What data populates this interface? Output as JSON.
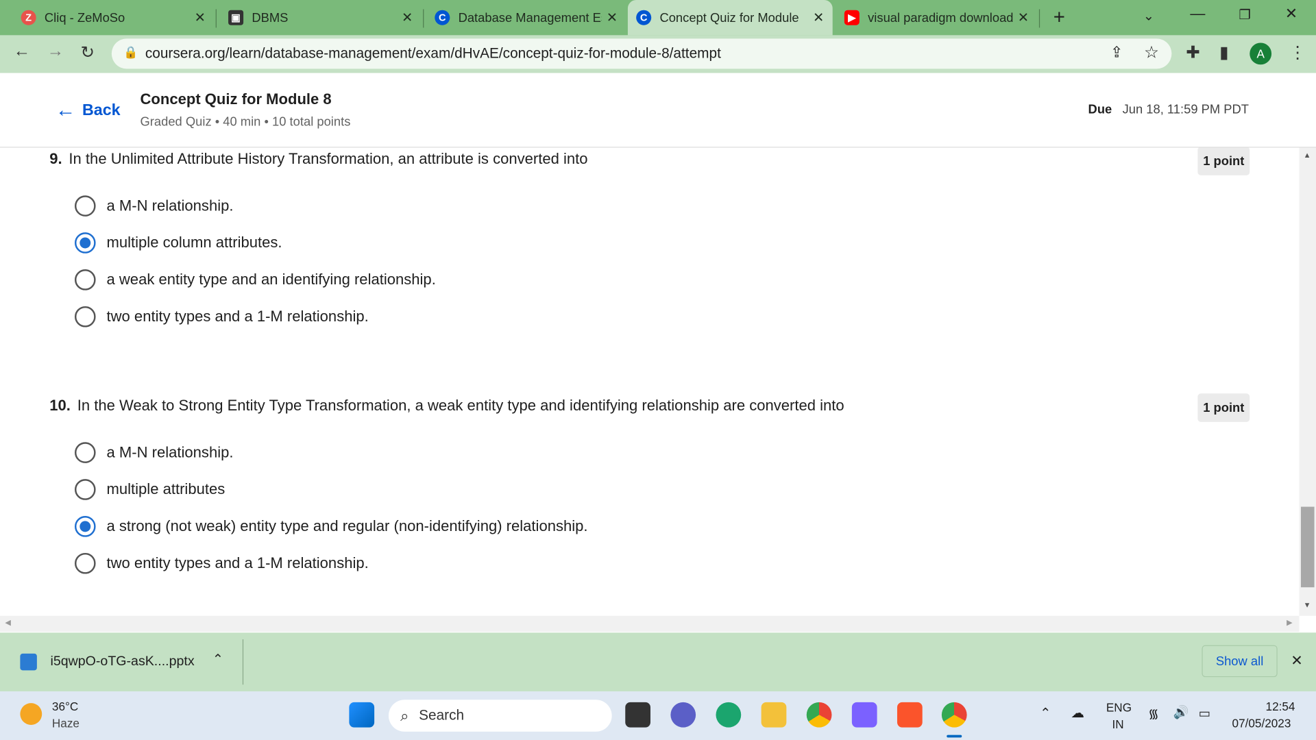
{
  "browser": {
    "tabs": [
      {
        "title": "Cliq - ZeMoSo",
        "icon": "cliq-icon",
        "color": "#e8534b"
      },
      {
        "title": "DBMS",
        "icon": "notion-icon",
        "color": "#333333"
      },
      {
        "title": "Database Management Es",
        "icon": "coursera-icon",
        "color": "#0056d2"
      },
      {
        "title": "Concept Quiz for Module",
        "icon": "coursera-icon",
        "color": "#0056d2",
        "active": true
      },
      {
        "title": "visual paradigm download",
        "icon": "youtube-icon",
        "color": "#ff0000"
      }
    ],
    "url": "coursera.org/learn/database-management/exam/dHvAE/concept-quiz-for-module-8/attempt",
    "profile_initial": "A"
  },
  "header": {
    "back": "Back",
    "title": "Concept Quiz for Module 8",
    "subtitle": "Graded Quiz • 40 min • 10 total points",
    "due_label": "Due",
    "due_value": "Jun 18, 11:59 PM PDT"
  },
  "questions": [
    {
      "number": "9.",
      "text": "In the Unlimited Attribute History Transformation, an attribute is converted into",
      "points": "1 point",
      "options": [
        "a M-N relationship.",
        "multiple column attributes.",
        "a weak entity type and an identifying relationship.",
        "two entity types and a 1-M relationship."
      ],
      "selected": 1
    },
    {
      "number": "10.",
      "text": "In the Weak to Strong Entity Type Transformation, a weak entity type and identifying relationship are converted into",
      "points": "1 point",
      "options": [
        "a M-N relationship.",
        "multiple attributes",
        "a strong (not weak) entity type and regular (non-identifying) relationship.",
        "two entity types and a 1-M relationship."
      ],
      "selected": 2
    }
  ],
  "download": {
    "file": "i5qwpO-oTG-asK....pptx",
    "show_all": "Show all"
  },
  "taskbar": {
    "temp": "36°C",
    "weather": "Haze",
    "search": "Search",
    "lang1": "ENG",
    "lang2": "IN",
    "time": "12:54",
    "date": "07/05/2023"
  },
  "colors": {
    "accent": "#1f6fd0",
    "tabbar": "#7aba7a",
    "toolbar": "#c4e1c4"
  }
}
